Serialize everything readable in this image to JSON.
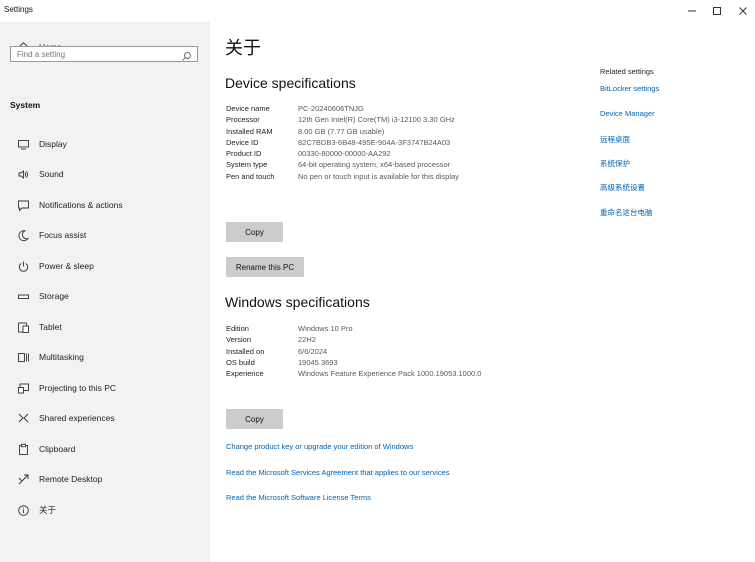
{
  "window": {
    "title": "Settings",
    "minimize_icon": "minimize-icon",
    "maximize_icon": "maximize-icon",
    "close_icon": "close-icon"
  },
  "sidebar": {
    "home_label": "Home",
    "search_placeholder": "Find a setting",
    "search_value": "",
    "section_title": "System",
    "items": [
      {
        "label": "Display",
        "icon": "display-icon"
      },
      {
        "label": "Sound",
        "icon": "sound-icon"
      },
      {
        "label": "Notifications & actions",
        "icon": "notifications-icon"
      },
      {
        "label": "Focus assist",
        "icon": "focus-assist-icon"
      },
      {
        "label": "Power & sleep",
        "icon": "power-icon"
      },
      {
        "label": "Storage",
        "icon": "storage-icon"
      },
      {
        "label": "Tablet",
        "icon": "tablet-icon"
      },
      {
        "label": "Multitasking",
        "icon": "multitasking-icon"
      },
      {
        "label": "Projecting to this PC",
        "icon": "projecting-icon"
      },
      {
        "label": "Shared experiences",
        "icon": "shared-experiences-icon"
      },
      {
        "label": "Clipboard",
        "icon": "clipboard-icon"
      },
      {
        "label": "Remote Desktop",
        "icon": "remote-desktop-icon"
      },
      {
        "label": "关于",
        "icon": "about-icon"
      }
    ]
  },
  "main": {
    "title": "关于",
    "device_specs": {
      "heading": "Device specifications",
      "rows": [
        {
          "key": "Device name",
          "value": "PC-20240606TNJG"
        },
        {
          "key": "Processor",
          "value": "12th Gen Intel(R) Core(TM) i3-12100   3.30 GHz"
        },
        {
          "key": "Installed RAM",
          "value": "8.00 GB (7.77 GB usable)"
        },
        {
          "key": "Device ID",
          "value": "82C7BDB3-6B48-495E-904A-3F3747B24A03"
        },
        {
          "key": "Product ID",
          "value": "00330-80000-00000-AA292"
        },
        {
          "key": "System type",
          "value": "64-bit operating system, x64-based processor"
        },
        {
          "key": "Pen and touch",
          "value": "No pen or touch input is available for this display"
        }
      ],
      "copy_label": "Copy",
      "rename_label": "Rename this PC"
    },
    "windows_specs": {
      "heading": "Windows specifications",
      "rows": [
        {
          "key": "Edition",
          "value": "Windows 10 Pro"
        },
        {
          "key": "Version",
          "value": "22H2"
        },
        {
          "key": "Installed on",
          "value": "6/6/2024"
        },
        {
          "key": "OS build",
          "value": "19045.3693"
        },
        {
          "key": "Experience",
          "value": "Windows Feature Experience Pack 1000.19053.1000.0"
        }
      ],
      "copy_label": "Copy"
    },
    "links": [
      "Change product key or upgrade your edition of Windows",
      "Read the Microsoft Services Agreement that applies to our services",
      "Read the Microsoft Software License Terms"
    ]
  },
  "related": {
    "heading": "Related settings",
    "links": [
      "BitLocker settings",
      "Device Manager",
      "远程桌面",
      "系统保护",
      "高级系统设置",
      "重命名这台电脑"
    ]
  },
  "colors": {
    "sidebar_bg": "#f2f2f2",
    "link": "#0063b1",
    "button_bg": "#cccccc"
  }
}
